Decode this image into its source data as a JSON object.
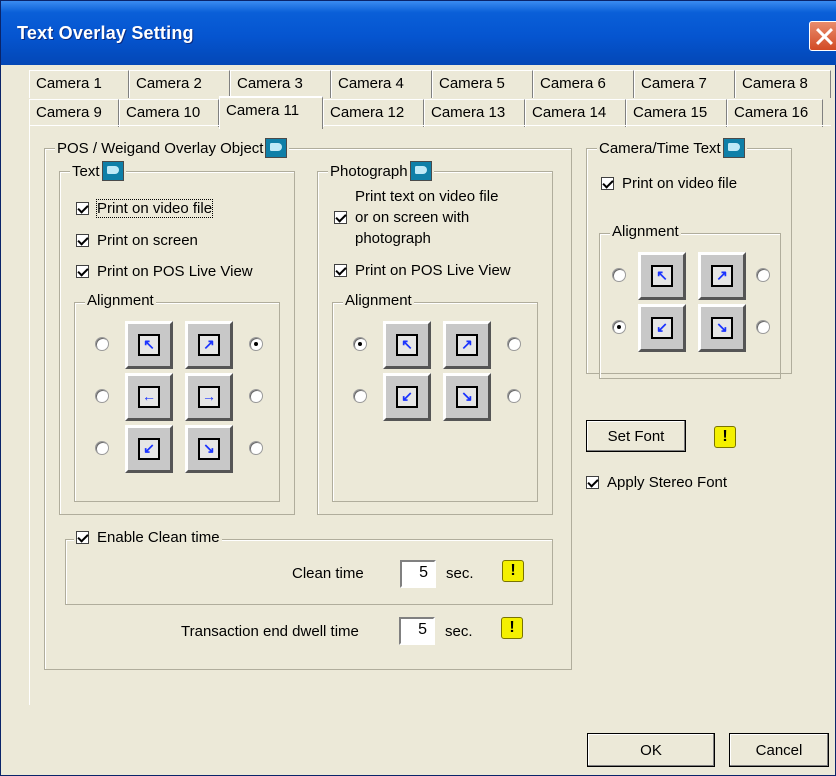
{
  "window": {
    "title": "Text Overlay Setting",
    "close_icon": "close-icon"
  },
  "tabs_row1": [
    "Camera 1",
    "Camera 2",
    "Camera 3",
    "Camera 4",
    "Camera 5",
    "Camera 6",
    "Camera 7",
    "Camera 8"
  ],
  "tabs_row2": [
    "Camera 9",
    "Camera 10",
    "Camera 11",
    "Camera 12",
    "Camera 13",
    "Camera 14",
    "Camera 15",
    "Camera 16"
  ],
  "active_tab": "Camera 11",
  "pos_group": {
    "title": "POS / Weigand Overlay Object",
    "text_group": {
      "title": "Text",
      "print_on_video_file": "Print on video file",
      "print_on_screen": "Print on screen",
      "print_on_pos_live_view": "Print on POS Live View",
      "alignment_title": "Alignment",
      "selected_alignment": "top-right"
    },
    "photo_group": {
      "title": "Photograph",
      "print_text_line1": "Print text on video file",
      "print_text_line2": "or on screen with",
      "print_text_line3": "photograph",
      "print_on_pos_live_view": "Print on POS Live View",
      "alignment_title": "Alignment",
      "selected_alignment": "top-left"
    },
    "enable_clean_time": "Enable Clean time",
    "clean_time_label": "Clean time",
    "clean_time_value": "5",
    "clean_time_unit": "sec.",
    "dwell_label": "Transaction end dwell time",
    "dwell_value": "5",
    "dwell_unit": "sec."
  },
  "camera_time_group": {
    "title": "Camera/Time Text",
    "print_on_video_file": "Print on video file",
    "alignment_title": "Alignment",
    "selected_alignment": "bottom-left"
  },
  "set_font": "Set Font",
  "apply_stereo_font": "Apply Stereo Font",
  "warn_glyph": "!",
  "ok": "OK",
  "cancel": "Cancel"
}
